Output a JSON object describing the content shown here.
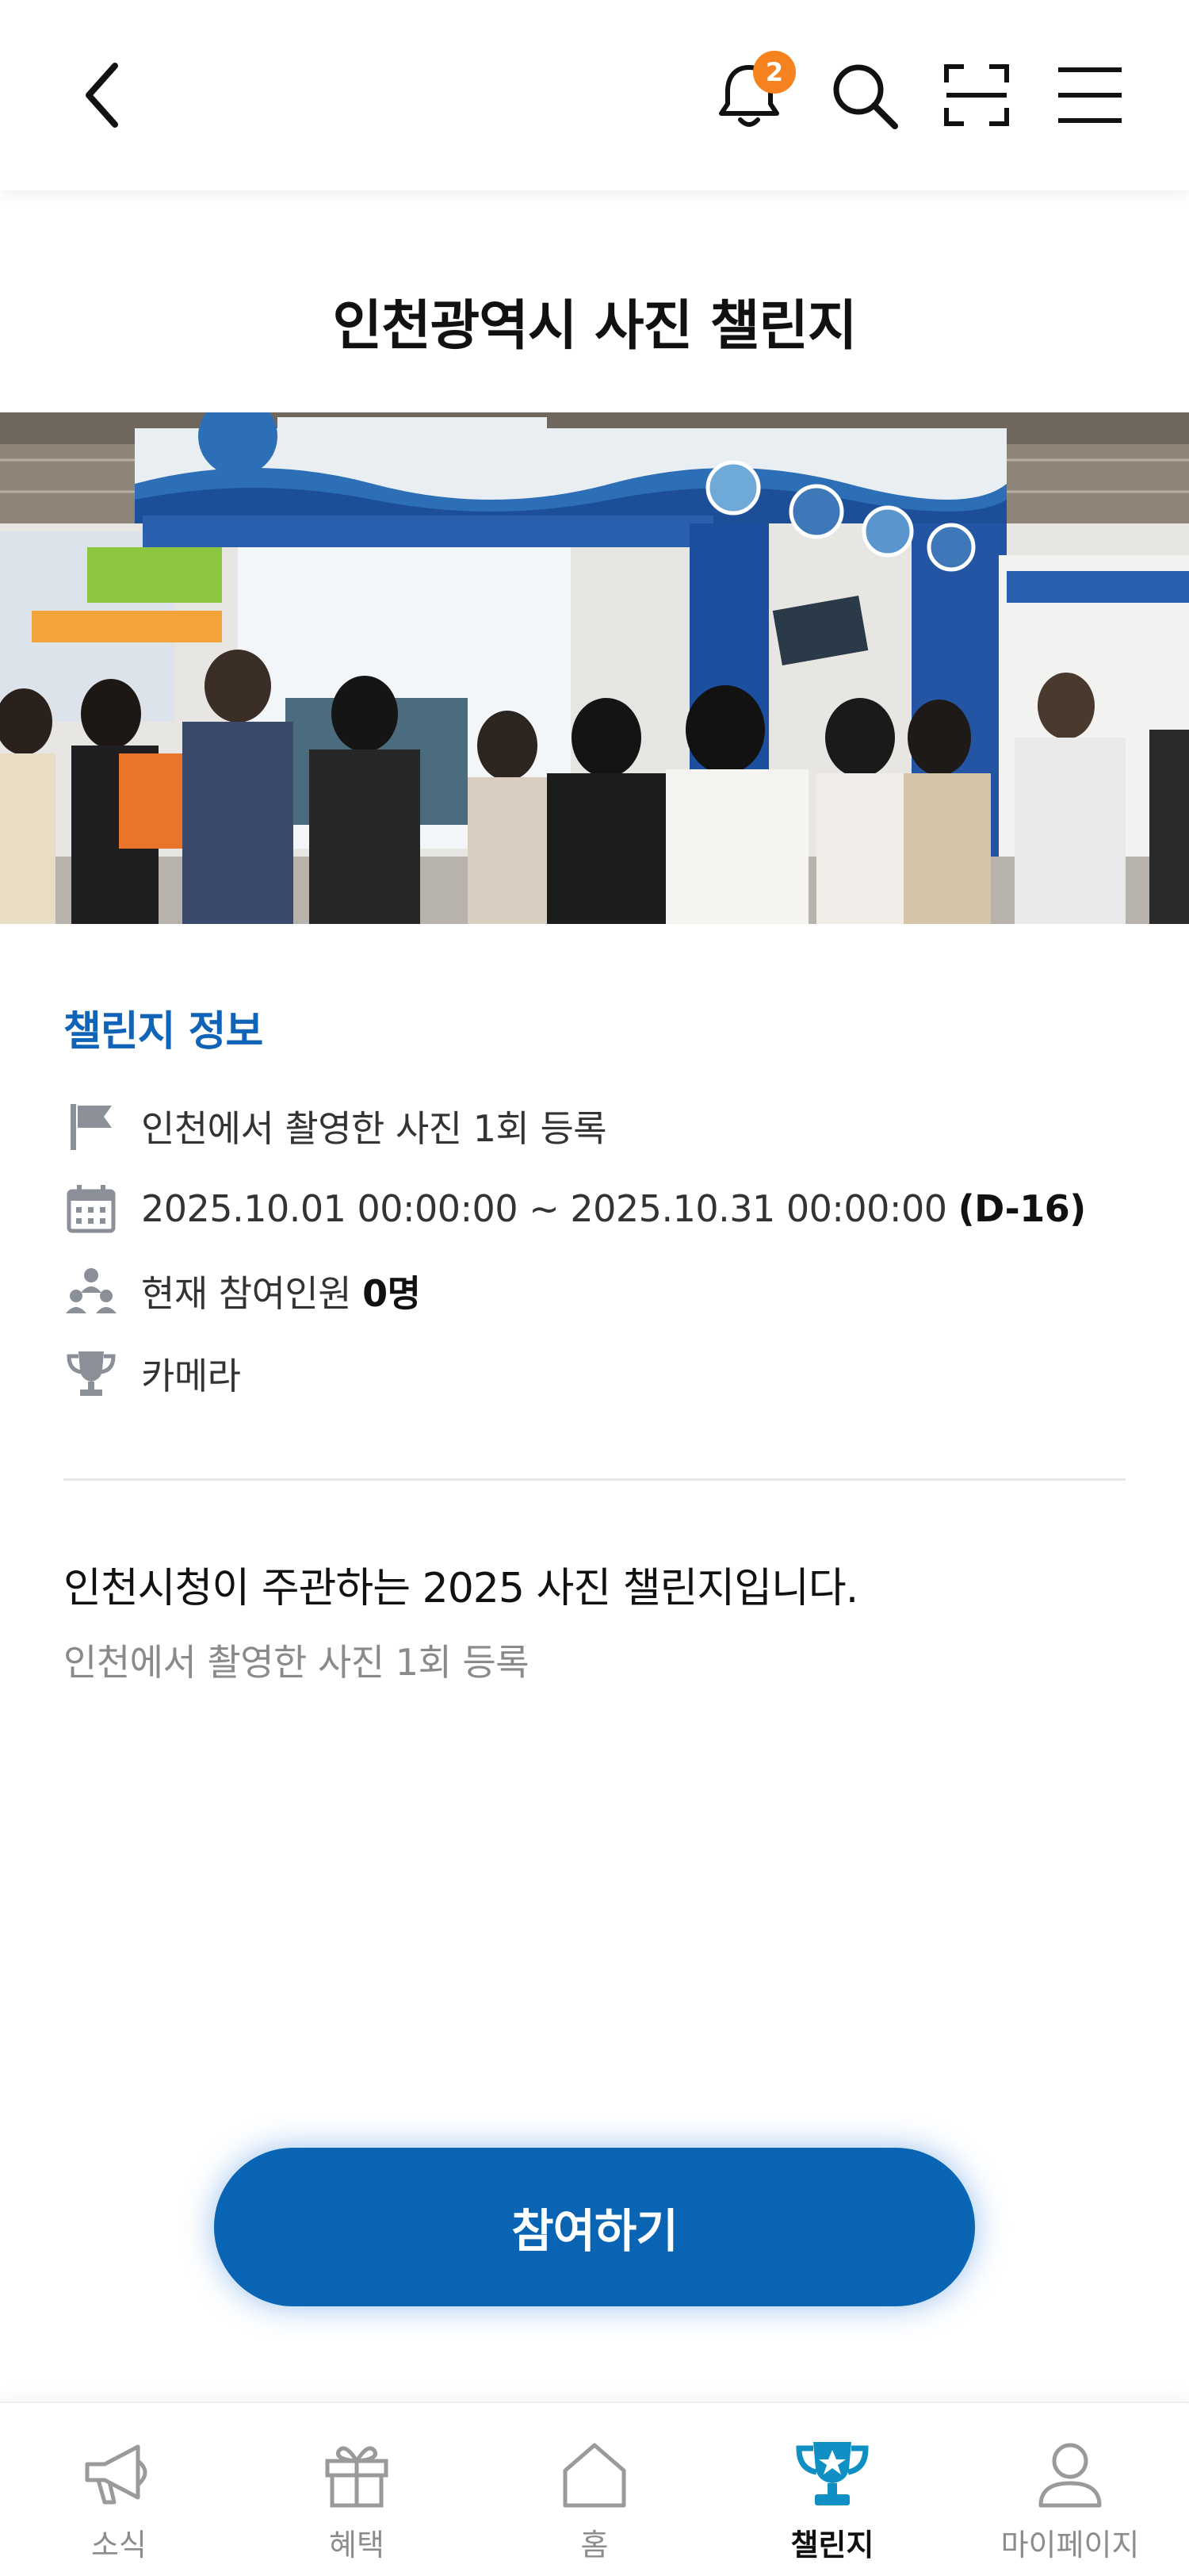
{
  "header": {
    "notification_count": "2"
  },
  "page": {
    "title": "인천광역시 사진 챌린지"
  },
  "challenge_info": {
    "section_title": "챌린지 정보",
    "mission": "인천에서 촬영한 사진 1회 등록",
    "period": "2025.10.01 00:00:00 ~ 2025.10.31 00:00:00",
    "dday": "(D-16)",
    "participants_label": "현재 참여인원",
    "participants_count": "0명",
    "reward": "카메라"
  },
  "description": {
    "title": "인천시청이 주관하는 2025 사진 챌린지입니다.",
    "subtitle": "인천에서 촬영한 사진 1회 등록"
  },
  "actions": {
    "join_label": "참여하기"
  },
  "bottom_nav": {
    "items": [
      {
        "label": "소식",
        "icon": "megaphone-icon"
      },
      {
        "label": "혜택",
        "icon": "gift-icon"
      },
      {
        "label": "홈",
        "icon": "home-icon"
      },
      {
        "label": "챌린지",
        "icon": "trophy-icon",
        "active": true
      },
      {
        "label": "마이페이지",
        "icon": "person-icon"
      }
    ]
  },
  "colors": {
    "accent": "#0F64B8",
    "button": "#0A64B4",
    "badge": "#F5821F"
  }
}
